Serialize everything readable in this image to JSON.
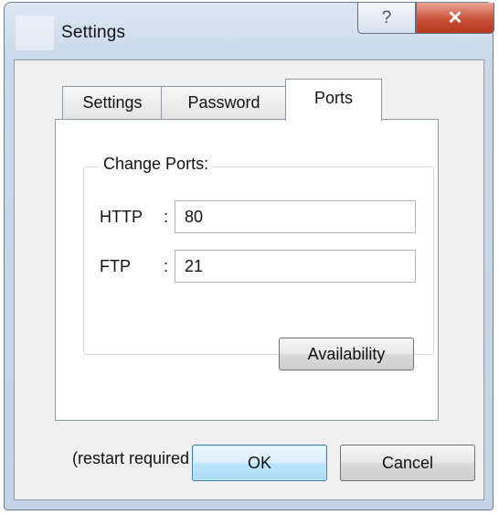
{
  "window": {
    "title": "Settings",
    "help_glyph": "?",
    "close_glyph": "✕"
  },
  "tabs": [
    {
      "label": "Settings",
      "selected": false
    },
    {
      "label": "Password",
      "selected": false
    },
    {
      "label": "Ports",
      "selected": true
    }
  ],
  "ports_panel": {
    "group_label": "Change Ports:",
    "http": {
      "label": "HTTP",
      "colon": ":",
      "value": "80"
    },
    "ftp": {
      "label": "FTP",
      "colon": ":",
      "value": "21"
    },
    "availability_label": "Availability"
  },
  "note": "(restart required to apply changes)",
  "buttons": {
    "ok_label": "OK",
    "cancel_label": "Cancel"
  },
  "colors": {
    "frame": "#c9d9ea",
    "close_button": "#c9513a",
    "default_button_border": "#3c7fb1"
  },
  "icons": [
    "help-icon",
    "close-icon"
  ]
}
